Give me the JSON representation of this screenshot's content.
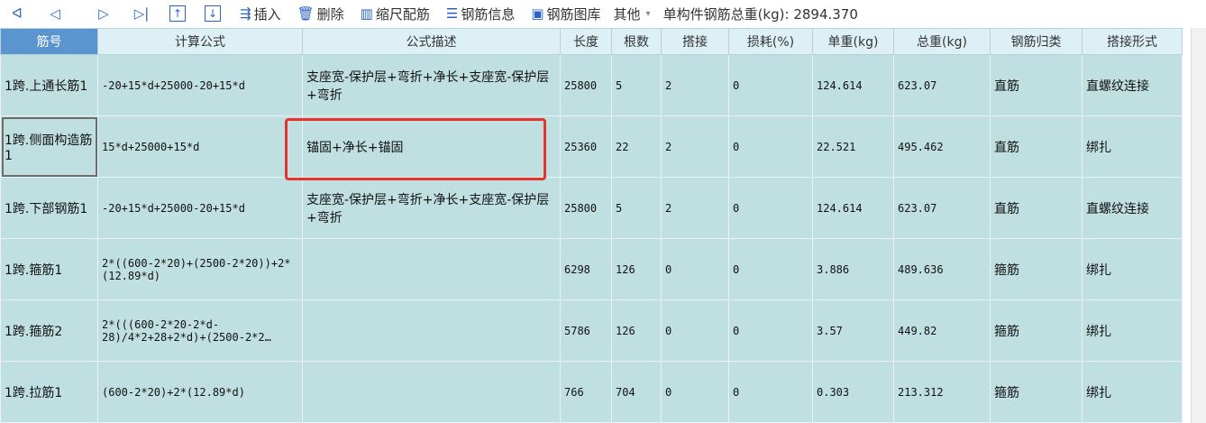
{
  "toolbar": {
    "nav": [
      {
        "icon": "first-page-icon",
        "glyph": "ᐊ"
      },
      {
        "icon": "prev-page-icon",
        "glyph": "◁"
      },
      {
        "icon": "next-page-icon",
        "glyph": "▷"
      },
      {
        "icon": "last-page-icon",
        "glyph": "▷|"
      }
    ],
    "insert_label": "插入",
    "delete_label": "删除",
    "scale_label": "缩尺配筋",
    "info_label": "钢筋信息",
    "library_label": "钢筋图库",
    "other_label": "其他",
    "total_weight_label": "单构件钢筋总重(kg): 2894.370"
  },
  "table": {
    "headers": [
      "筋号",
      "计算公式",
      "公式描述",
      "长度",
      "根数",
      "搭接",
      "损耗(%)",
      "单重(kg)",
      "总重(kg)",
      "钢筋归类",
      "搭接形式"
    ],
    "rows": [
      {
        "name": "1跨.上通长筋1",
        "formula": "-20+15*d+25000-20+15*d",
        "desc": "支座宽-保护层+弯折+净长+支座宽-保护层+弯折",
        "length": "25800",
        "count": "5",
        "lap": "2",
        "loss": "0",
        "unit_weight": "124.614",
        "total_weight": "623.07",
        "category": "直筋",
        "lap_type": "直螺纹连接"
      },
      {
        "name": "1跨.侧面构造筋1",
        "formula": "15*d+25000+15*d",
        "desc": "锚固+净长+锚固",
        "length": "25360",
        "count": "22",
        "lap": "2",
        "loss": "0",
        "unit_weight": "22.521",
        "total_weight": "495.462",
        "category": "直筋",
        "lap_type": "绑扎"
      },
      {
        "name": "1跨.下部钢筋1",
        "formula": "-20+15*d+25000-20+15*d",
        "desc": "支座宽-保护层+弯折+净长+支座宽-保护层+弯折",
        "length": "25800",
        "count": "5",
        "lap": "2",
        "loss": "0",
        "unit_weight": "124.614",
        "total_weight": "623.07",
        "category": "直筋",
        "lap_type": "直螺纹连接"
      },
      {
        "name": "1跨.箍筋1",
        "formula": "2*((600-2*20)+(2500-2*20))+2*(12.89*d)",
        "desc": "",
        "length": "6298",
        "count": "126",
        "lap": "0",
        "loss": "0",
        "unit_weight": "3.886",
        "total_weight": "489.636",
        "category": "箍筋",
        "lap_type": "绑扎"
      },
      {
        "name": "1跨.箍筋2",
        "formula": "2*(((600-2*20-2*d-28)/4*2+28+2*d)+(2500-2*2…",
        "desc": "",
        "length": "5786",
        "count": "126",
        "lap": "0",
        "loss": "0",
        "unit_weight": "3.57",
        "total_weight": "449.82",
        "category": "箍筋",
        "lap_type": "绑扎"
      },
      {
        "name": "1跨.拉筋1",
        "formula": "(600-2*20)+2*(12.89*d)",
        "desc": "",
        "length": "766",
        "count": "704",
        "lap": "0",
        "loss": "0",
        "unit_weight": "0.303",
        "total_weight": "213.312",
        "category": "箍筋",
        "lap_type": "绑扎"
      }
    ]
  },
  "colors": {
    "row_bg": "#c0dfe1",
    "header_bg": "#ddf0f6",
    "first_header_bg": "#5b95cf",
    "highlight": "#e8322c",
    "red_text": "#e02020"
  }
}
